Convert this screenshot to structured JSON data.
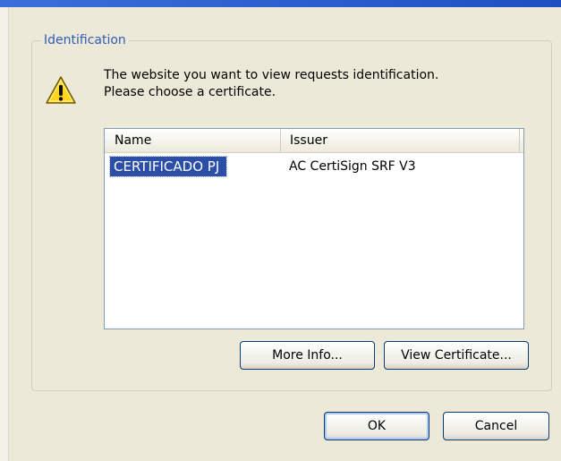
{
  "dialog": {
    "group_title": "Identification",
    "message_line1": "The website you want to view requests identification.",
    "message_line2": "Please choose a certificate.",
    "icon": "warning-icon"
  },
  "certificate_list": {
    "columns": [
      "Name",
      "Issuer"
    ],
    "rows": [
      {
        "name": "CERTIFICADO PJ",
        "issuer": "AC CertiSign SRF V3",
        "selected": true
      }
    ]
  },
  "buttons": {
    "more_info": "More Info...",
    "view_certificate": "View Certificate...",
    "ok": "OK",
    "cancel": "Cancel"
  }
}
